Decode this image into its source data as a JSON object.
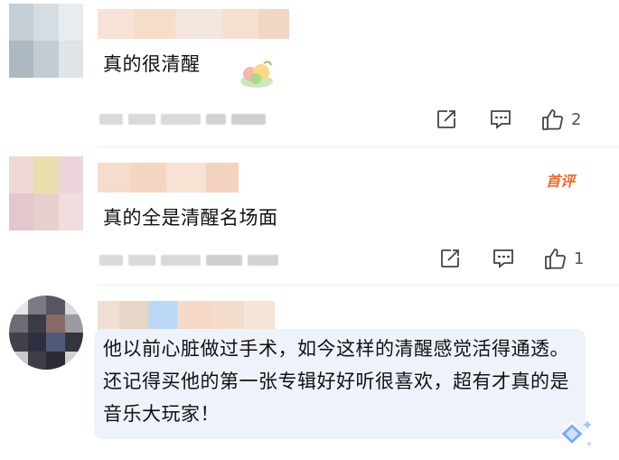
{
  "comments": [
    {
      "text": "真的很清醒",
      "like_count": "2"
    },
    {
      "text": "真的全是清醒名场面",
      "badge": "首评",
      "like_count": "1"
    },
    {
      "text": "他以前心脏做过手术，如今这样的清醒感觉活得通透。还记得买他的第一张专辑好好听很喜欢，超有才真的是音乐大玩家！"
    }
  ],
  "icons": [
    "share-icon",
    "comment-icon",
    "like-icon",
    "sticker-icon",
    "sparkle-diamond-icon"
  ],
  "colors": {
    "badge": "#f06a2a",
    "bubble": "#eef2fb",
    "icon": "#444444"
  }
}
